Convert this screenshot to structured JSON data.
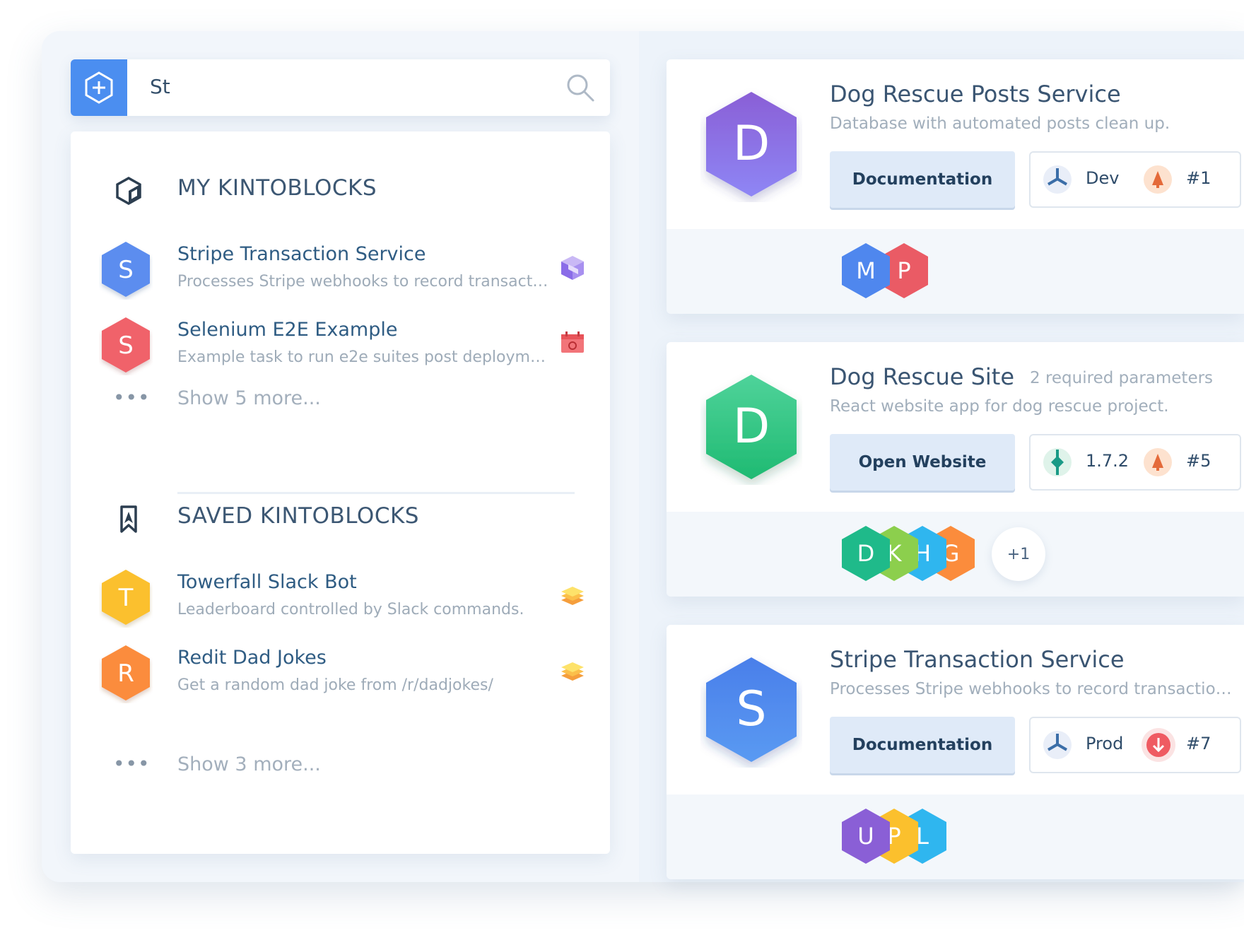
{
  "search": {
    "query": "St"
  },
  "left_panel": {
    "my_section": {
      "title": "MY KINTOBLOCKS",
      "items": [
        {
          "letter": "S",
          "title": "Stripe Transaction Service",
          "description": "Processes Stripe webhooks to record transactio...",
          "color": "#5b8def",
          "badge": "purple-cube-icon"
        },
        {
          "letter": "S",
          "title": "Selenium E2E Example",
          "description": "Example task to run e2e suites post deploymen...",
          "color": "#f0626a",
          "badge": "red-calendar-icon"
        }
      ],
      "more_label": "Show 5 more..."
    },
    "saved_section": {
      "title": "SAVED KINTOBLOCKS",
      "items": [
        {
          "letter": "T",
          "title": "Towerfall Slack Bot",
          "description": "Leaderboard controlled by Slack commands.",
          "color": "#fbc02d",
          "badge": "layers-icon"
        },
        {
          "letter": "R",
          "title": "Redit Dad Jokes",
          "description": "Get a random dad joke from /r/dadjokes/",
          "color": "#fb8c3c",
          "badge": "layers-icon"
        }
      ],
      "more_label": "Show 3 more..."
    },
    "dots": "•••"
  },
  "cards": [
    {
      "letter": "D",
      "title": "Dog Rescue Posts Service",
      "required": "",
      "description": "Database with automated posts clean up.",
      "button": "Documentation",
      "env_label": "Dev",
      "build": "#1",
      "hex_color": "#8b6cf0",
      "members": [
        "M",
        "P"
      ],
      "extra": ""
    },
    {
      "letter": "D",
      "title": "Dog Rescue Site",
      "required": "2 required parameters",
      "description": "React website app for dog rescue project.",
      "button": "Open Website",
      "env_label": "1.7.2",
      "build": "#5",
      "hex_color": "#2ecb86",
      "members": [
        "D",
        "K",
        "H",
        "G"
      ],
      "extra": "+1"
    },
    {
      "letter": "S",
      "title": "Stripe Transaction Service",
      "required": "",
      "description": "Processes Stripe webhooks to record transaction ev...",
      "button": "Documentation",
      "env_label": "Prod",
      "build": "#7",
      "hex_color": "#4a86ef",
      "members": [
        "U",
        "P",
        "L"
      ],
      "extra": ""
    }
  ]
}
